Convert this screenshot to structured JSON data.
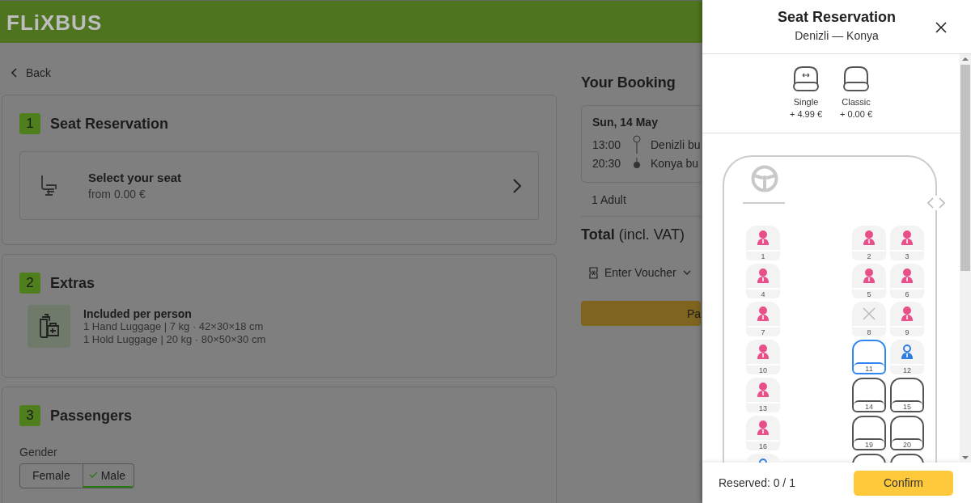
{
  "header": {
    "logo": "FLiXBUS"
  },
  "back": "Back",
  "steps": [
    {
      "number": "1",
      "title": "Seat Reservation",
      "kind": "seat",
      "option": {
        "title": "Select your seat",
        "subtitle": "from 0.00 €"
      }
    },
    {
      "number": "2",
      "title": "Extras",
      "kind": "extras",
      "included": {
        "title": "Included per person",
        "lines": [
          "1 Hand Luggage | 7 kg · 42×30×18 cm",
          "1 Hold Luggage | 20 kg · 80×50×30 cm"
        ]
      }
    },
    {
      "number": "3",
      "title": "Passengers",
      "kind": "passengers",
      "gender": {
        "label": "Gender",
        "options": [
          {
            "label": "Female",
            "selected": false
          },
          {
            "label": "Male",
            "selected": true
          }
        ]
      }
    }
  ],
  "booking": {
    "title": "Your Booking",
    "date": "Sun, 14 May",
    "stops": [
      {
        "time": "13:00",
        "place": "Denizli bu",
        "kind": "departure"
      },
      {
        "time": "20:30",
        "place": "Konya bu",
        "kind": "arrival"
      }
    ],
    "passengers": "1 Adult",
    "total_label": "**Total** (incl. VAT)",
    "voucher": "Enter Voucher",
    "pay_button": "Pa"
  },
  "drawer": {
    "title": "Seat Reservation",
    "route": "Denizli — Konya",
    "seat_types": [
      {
        "label": "Single",
        "price": "+ 4.99 €",
        "kind": "single"
      },
      {
        "label": "Classic",
        "price": "+ 0.00 €",
        "kind": "classic"
      }
    ],
    "rows": [
      {
        "left": [
          {
            "number": "1",
            "kind": "female"
          }
        ],
        "right": [
          {
            "number": "2",
            "kind": "female"
          },
          {
            "number": "3",
            "kind": "female"
          }
        ]
      },
      {
        "left": [
          {
            "number": "4",
            "kind": "female"
          }
        ],
        "right": [
          {
            "number": "5",
            "kind": "female"
          },
          {
            "number": "6",
            "kind": "female"
          }
        ]
      },
      {
        "left": [
          {
            "number": "7",
            "kind": "female"
          }
        ],
        "right": [
          {
            "number": "8",
            "kind": "blocked"
          },
          {
            "number": "9",
            "kind": "female"
          }
        ]
      },
      {
        "left": [
          {
            "number": "10",
            "kind": "female"
          }
        ],
        "right": [
          {
            "number": "11",
            "kind": "selected"
          },
          {
            "number": "12",
            "kind": "male"
          }
        ]
      },
      {
        "left": [
          {
            "number": "13",
            "kind": "female"
          }
        ],
        "right": [
          {
            "number": "14",
            "kind": "free"
          },
          {
            "number": "15",
            "kind": "free"
          }
        ]
      },
      {
        "left": [
          {
            "number": "16",
            "kind": "female"
          }
        ],
        "right": [
          {
            "number": "19",
            "kind": "free"
          },
          {
            "number": "20",
            "kind": "free"
          }
        ]
      },
      {
        "left": [
          {
            "kind": "male"
          }
        ],
        "right": [
          {
            "kind": "free"
          },
          {
            "kind": "free"
          }
        ]
      }
    ],
    "reserved": "Reserved: 0 / 1",
    "confirm": "Confirm"
  }
}
